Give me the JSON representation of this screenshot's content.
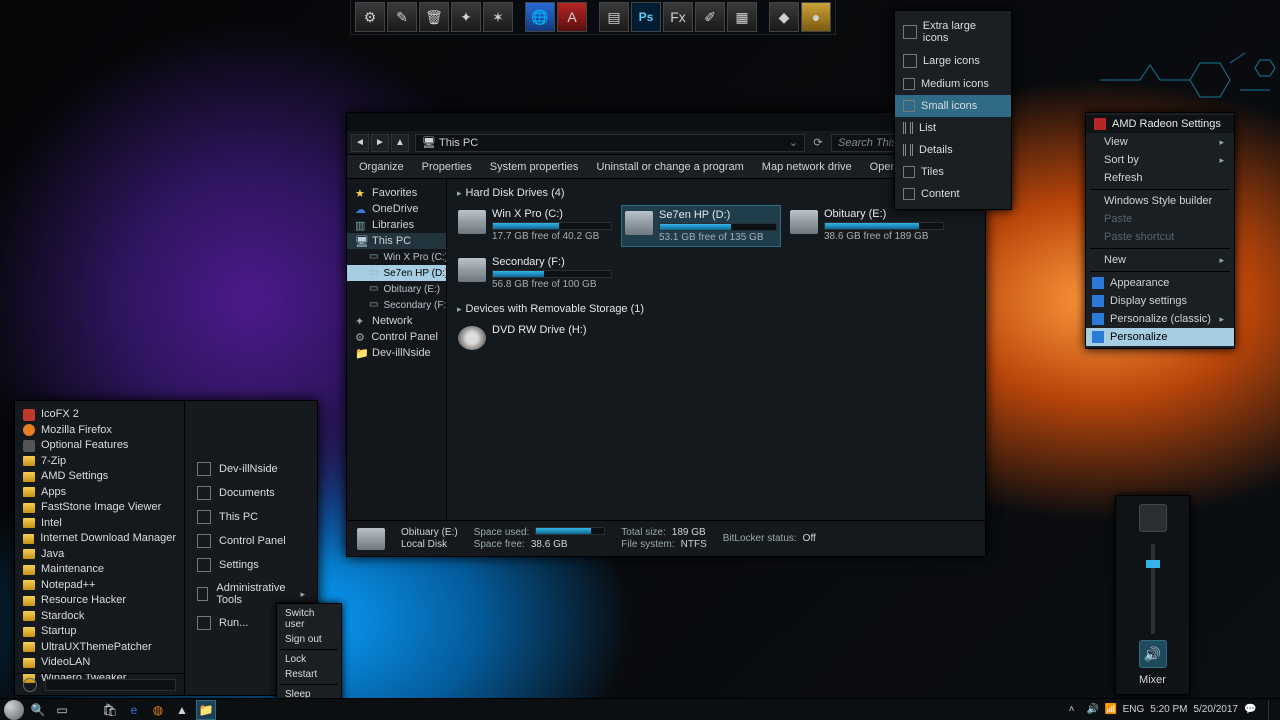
{
  "dock": {
    "items": [
      "sys",
      "util",
      "trash",
      "tool",
      "brush",
      "",
      "globe",
      "amd",
      "",
      "note",
      "ps",
      "fx",
      "paint",
      "color",
      "",
      "gal",
      "orb"
    ]
  },
  "explorer": {
    "title": "This PC",
    "search_placeholder": "Search This PC",
    "toolbar": {
      "organize": "Organize",
      "properties": "Properties",
      "sysprops": "System properties",
      "uninstall": "Uninstall or change a program",
      "mapdrive": "Map network drive",
      "settings": "Open Settings"
    },
    "sidebar": {
      "favorites": "Favorites",
      "onedrive": "OneDrive",
      "libraries": "Libraries",
      "thispc": "This PC",
      "drives": {
        "c": "Win X Pro (C:)",
        "d": "Se7en HP (D:)",
        "e": "Obituary (E:)",
        "f": "Secondary (F:)"
      },
      "network": "Network",
      "controlpanel": "Control Panel",
      "user": "Dev-illNside"
    },
    "groups": {
      "hdd": "Hard Disk Drives (4)",
      "removable": "Devices with Removable Storage (1)"
    },
    "drives": {
      "c": {
        "name": "Win X Pro (C:)",
        "free": "17.7 GB free of 40.2 GB",
        "fill_pct": 56
      },
      "d": {
        "name": "Se7en HP (D:)",
        "free": "53.1 GB free of 135 GB",
        "fill_pct": 61
      },
      "e": {
        "name": "Obituary (E:)",
        "free": "38.6 GB free of 189 GB",
        "fill_pct": 80
      },
      "f": {
        "name": "Secondary (F:)",
        "free": "56.8 GB free of 100 GB",
        "fill_pct": 43
      },
      "h": {
        "name": "DVD RW Drive (H:)"
      }
    },
    "status": {
      "sel_name": "Obituary (E:)",
      "sel_type": "Local Disk",
      "space_used_label": "Space used:",
      "space_free_label": "Space free:",
      "space_free": "38.6 GB",
      "total_label": "Total size:",
      "total": "189 GB",
      "fs_label": "File system:",
      "fs": "NTFS",
      "bl_label": "BitLocker status:",
      "bl": "Off"
    }
  },
  "viewmenu": {
    "xl": "Extra large icons",
    "lg": "Large icons",
    "md": "Medium icons",
    "sm": "Small icons",
    "list": "List",
    "details": "Details",
    "tiles": "Tiles",
    "content": "Content"
  },
  "ctx": {
    "amd": "AMD Radeon Settings",
    "view": "View",
    "sort": "Sort by",
    "refresh": "Refresh",
    "wsb": "Windows Style builder",
    "paste": "Paste",
    "paste_sc": "Paste shortcut",
    "new": "New",
    "appearance": "Appearance",
    "display": "Display settings",
    "pers_classic": "Personalize (classic)",
    "personalize": "Personalize"
  },
  "start": {
    "left": {
      "icofx": "IcoFX 2",
      "firefox": "Mozilla Firefox",
      "optfeat": "Optional Features",
      "sevenzip": "7-Zip",
      "amd": "AMD Settings",
      "apps": "Apps",
      "faststone": "FastStone Image Viewer",
      "intel": "Intel",
      "idm": "Internet Download Manager",
      "java": "Java",
      "maint": "Maintenance",
      "npp": "Notepad++",
      "reshack": "Resource Hacker",
      "stardock": "Stardock",
      "startup": "Startup",
      "uux": "UltraUXThemePatcher",
      "vlan": "VideoLAN",
      "winaero": "Winaero Tweaker"
    },
    "right": {
      "user": "Dev-illNside",
      "documents": "Documents",
      "thispc": "This PC",
      "cp": "Control Panel",
      "settings": "Settings",
      "admin": "Administrative Tools",
      "run": "Run..."
    }
  },
  "power": {
    "switch": "Switch user",
    "signout": "Sign out",
    "lock": "Lock",
    "restart": "Restart",
    "sleep": "Sleep"
  },
  "volume": {
    "mixer": "Mixer"
  },
  "taskbar": {
    "lang": "ENG",
    "time": "5:20 PM",
    "date": "5/20/2017"
  }
}
